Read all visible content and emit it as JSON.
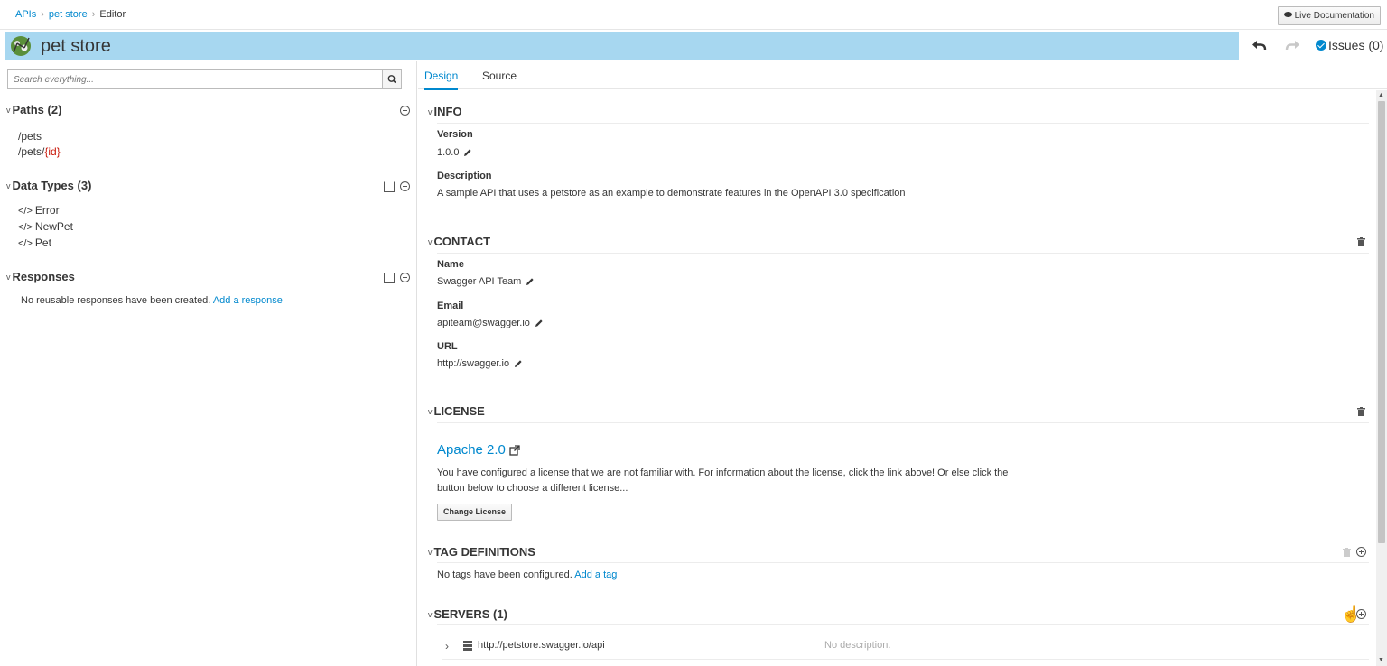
{
  "breadcrumb": {
    "apis": "APIs",
    "pet_store": "pet store",
    "current": "Editor",
    "separator": "›"
  },
  "header": {
    "live_doc_label": "Live Documentation",
    "title": "pet store",
    "issues_label": "Issues (0)"
  },
  "sidebar": {
    "search_placeholder": "Search everything...",
    "paths": {
      "heading": "Paths (2)",
      "items": [
        {
          "base": "/pets",
          "param": ""
        },
        {
          "base": "/pets/",
          "param": "{id}"
        }
      ]
    },
    "data_types": {
      "heading": "Data Types (3)",
      "code_glyph": "</>",
      "items": [
        "Error",
        "NewPet",
        "Pet"
      ]
    },
    "responses": {
      "heading": "Responses",
      "empty_text": "No reusable responses have been created.",
      "add_link": "Add a response"
    }
  },
  "tabs": {
    "design": "Design",
    "source": "Source"
  },
  "info": {
    "heading": "INFO",
    "version_label": "Version",
    "version": "1.0.0",
    "description_label": "Description",
    "description": "A sample API that uses a petstore as an example to demonstrate features in the OpenAPI 3.0 specification"
  },
  "contact": {
    "heading": "CONTACT",
    "name_label": "Name",
    "name": "Swagger API Team",
    "email_label": "Email",
    "email": "apiteam@swagger.io",
    "url_label": "URL",
    "url": "http://swagger.io"
  },
  "license": {
    "heading": "LICENSE",
    "name": "Apache 2.0",
    "text": "You have configured a license that we are not familiar with. For information about the license, click the link above! Or else click the button below to choose a different license...",
    "change_button": "Change License"
  },
  "tags": {
    "heading": "TAG DEFINITIONS",
    "empty_text": "No tags have been configured.",
    "add_link": "Add a tag"
  },
  "servers": {
    "heading": "SERVERS (1)",
    "items": [
      {
        "url": "http://petstore.swagger.io/api",
        "description": "No description."
      }
    ]
  },
  "colors": {
    "accent": "#0088ce",
    "title_bar": "#a7d7f0",
    "param": "#c9190b"
  }
}
